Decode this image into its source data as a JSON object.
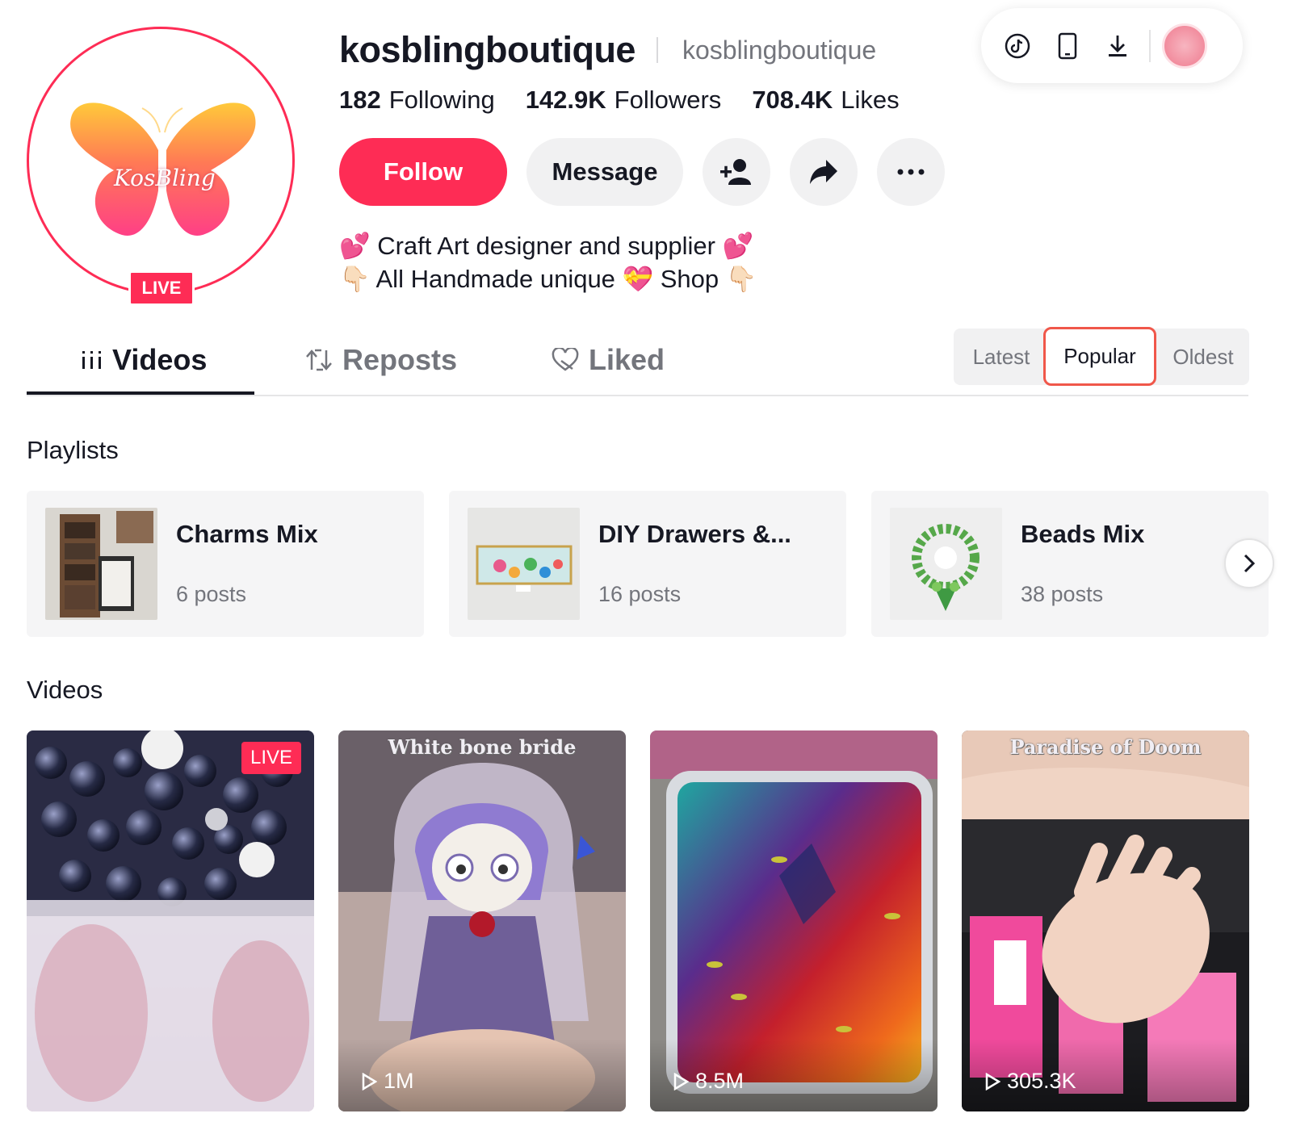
{
  "profile": {
    "username": "kosblingboutique",
    "nickname": "kosblingboutique",
    "live_badge": "LIVE",
    "avatar_text": "KosBling",
    "stats": [
      {
        "value": "182",
        "label": "Following"
      },
      {
        "value": "142.9K",
        "label": "Followers"
      },
      {
        "value": "708.4K",
        "label": "Likes"
      }
    ],
    "bio_line1": "💕 Craft Art designer and supplier 💕",
    "bio_line2": "👇🏻 All Handmade unique 💝 Shop 👇🏻"
  },
  "actions": {
    "follow_label": "Follow",
    "message_label": "Message"
  },
  "toolbar": {
    "icons": [
      "tiktok-icon",
      "mobile-icon",
      "download-icon"
    ]
  },
  "tabs": [
    {
      "label": "Videos",
      "active": true
    },
    {
      "label": "Reposts",
      "active": false
    },
    {
      "label": "Liked",
      "active": false
    }
  ],
  "sort": {
    "options": [
      "Latest",
      "Popular",
      "Oldest"
    ],
    "selected": "Popular"
  },
  "playlists": {
    "title": "Playlists",
    "items": [
      {
        "name": "Charms Mix",
        "count": "6 posts"
      },
      {
        "name": "DIY Drawers &...",
        "count": "16 posts"
      },
      {
        "name": "Beads Mix",
        "count": "38 posts"
      }
    ]
  },
  "videos": {
    "title": "Videos",
    "items": [
      {
        "views": "",
        "badge": "LIVE",
        "caption": ""
      },
      {
        "views": "1M",
        "badge": "",
        "caption": "White bone bride"
      },
      {
        "views": "8.5M",
        "badge": "",
        "caption": ""
      },
      {
        "views": "305.3K",
        "badge": "",
        "caption": "Paradise of Doom"
      }
    ]
  },
  "colors": {
    "accent": "#fe2c55",
    "text": "#161823",
    "muted": "#73757c",
    "surface": "#f1f1f2"
  }
}
